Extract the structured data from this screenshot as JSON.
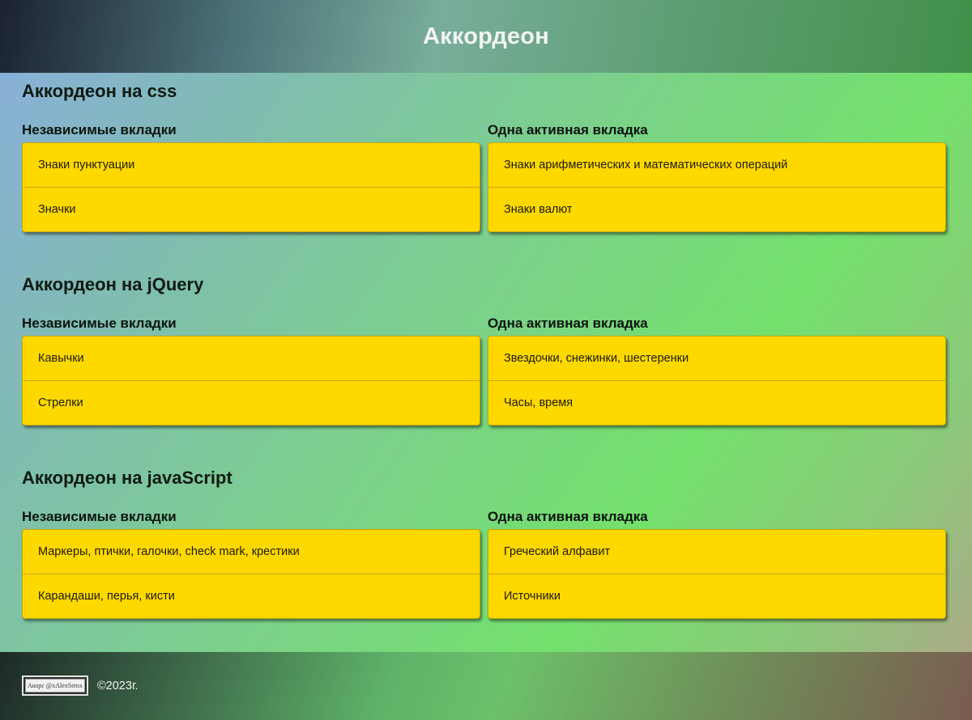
{
  "header": {
    "title": "Аккордеон"
  },
  "sections": [
    {
      "title": "Аккордеон на css",
      "left": {
        "title": "Независимые вкладки",
        "items": [
          "Знаки пунктуации",
          "Значки"
        ]
      },
      "right": {
        "title": "Одна активная вкладка",
        "items": [
          "Знаки арифметических и математических операций",
          "Знаки валют"
        ]
      }
    },
    {
      "title": "Аккордеон на jQuery",
      "left": {
        "title": "Независимые вкладки",
        "items": [
          "Кавычки",
          "Стрелки"
        ]
      },
      "right": {
        "title": "Одна активная вкладка",
        "items": [
          "Звездочки, снежинки, шестеренки",
          "Часы, время"
        ]
      }
    },
    {
      "title": "Аккордеон на javaScript",
      "left": {
        "title": "Независимые вкладки",
        "items": [
          "Маркеры, птички, галочки, check mark, крестики",
          "Карандаши, перья, кисти"
        ]
      },
      "right": {
        "title": "Одна активная вкладка",
        "items": [
          "Греческий алфавит",
          "Источники"
        ]
      }
    }
  ],
  "footer": {
    "logo_text": "Акорс @xAlexSemx",
    "copyright": "©2023г."
  },
  "colors": {
    "accordion_bg": "#ffd800",
    "header_text": "#f2f6f3"
  }
}
